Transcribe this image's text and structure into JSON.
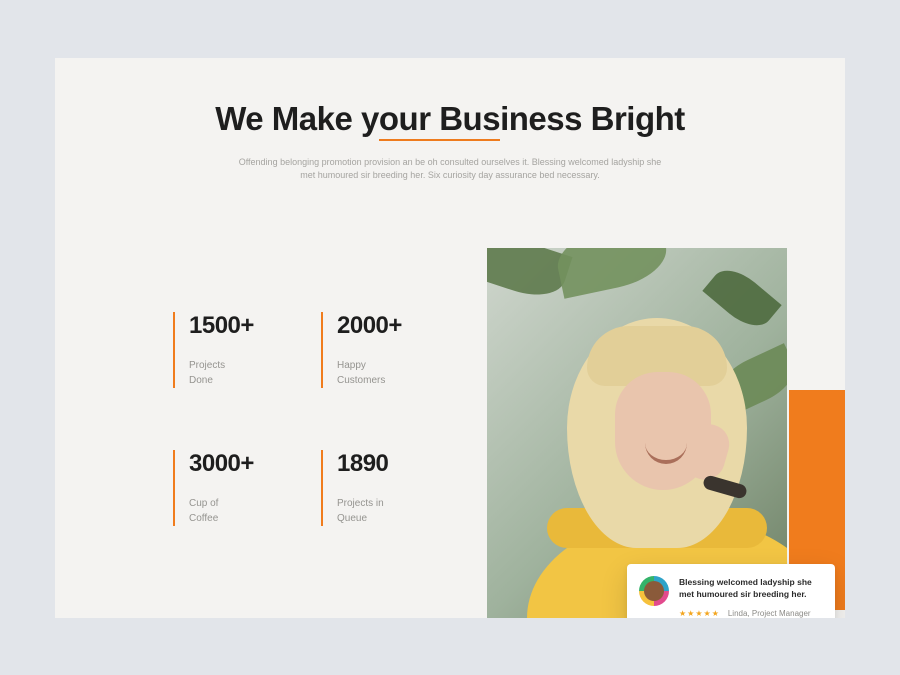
{
  "headline": {
    "pre": "We Make y",
    "underlined": "our Bus",
    "post": "iness Bright"
  },
  "subcopy": "Offending belonging promotion provision an be oh consulted ourselves it. Blessing welcomed ladyship she met humoured sir breeding her. Six curiosity day assurance bed necessary.",
  "stats": [
    {
      "value": "1500+",
      "label": "Projects\nDone"
    },
    {
      "value": "2000+",
      "label": "Happy\nCustomers"
    },
    {
      "value": "3000+",
      "label": "Cup of\nCoffee"
    },
    {
      "value": "1890",
      "label": "Projects in\nQueue"
    }
  ],
  "testimonial": {
    "quote": "Blessing welcomed ladyship she met humoured sir breeding her.",
    "stars": "★★★★★",
    "name": "Linda, Project Manager"
  },
  "colors": {
    "accent": "#f07c1d"
  }
}
